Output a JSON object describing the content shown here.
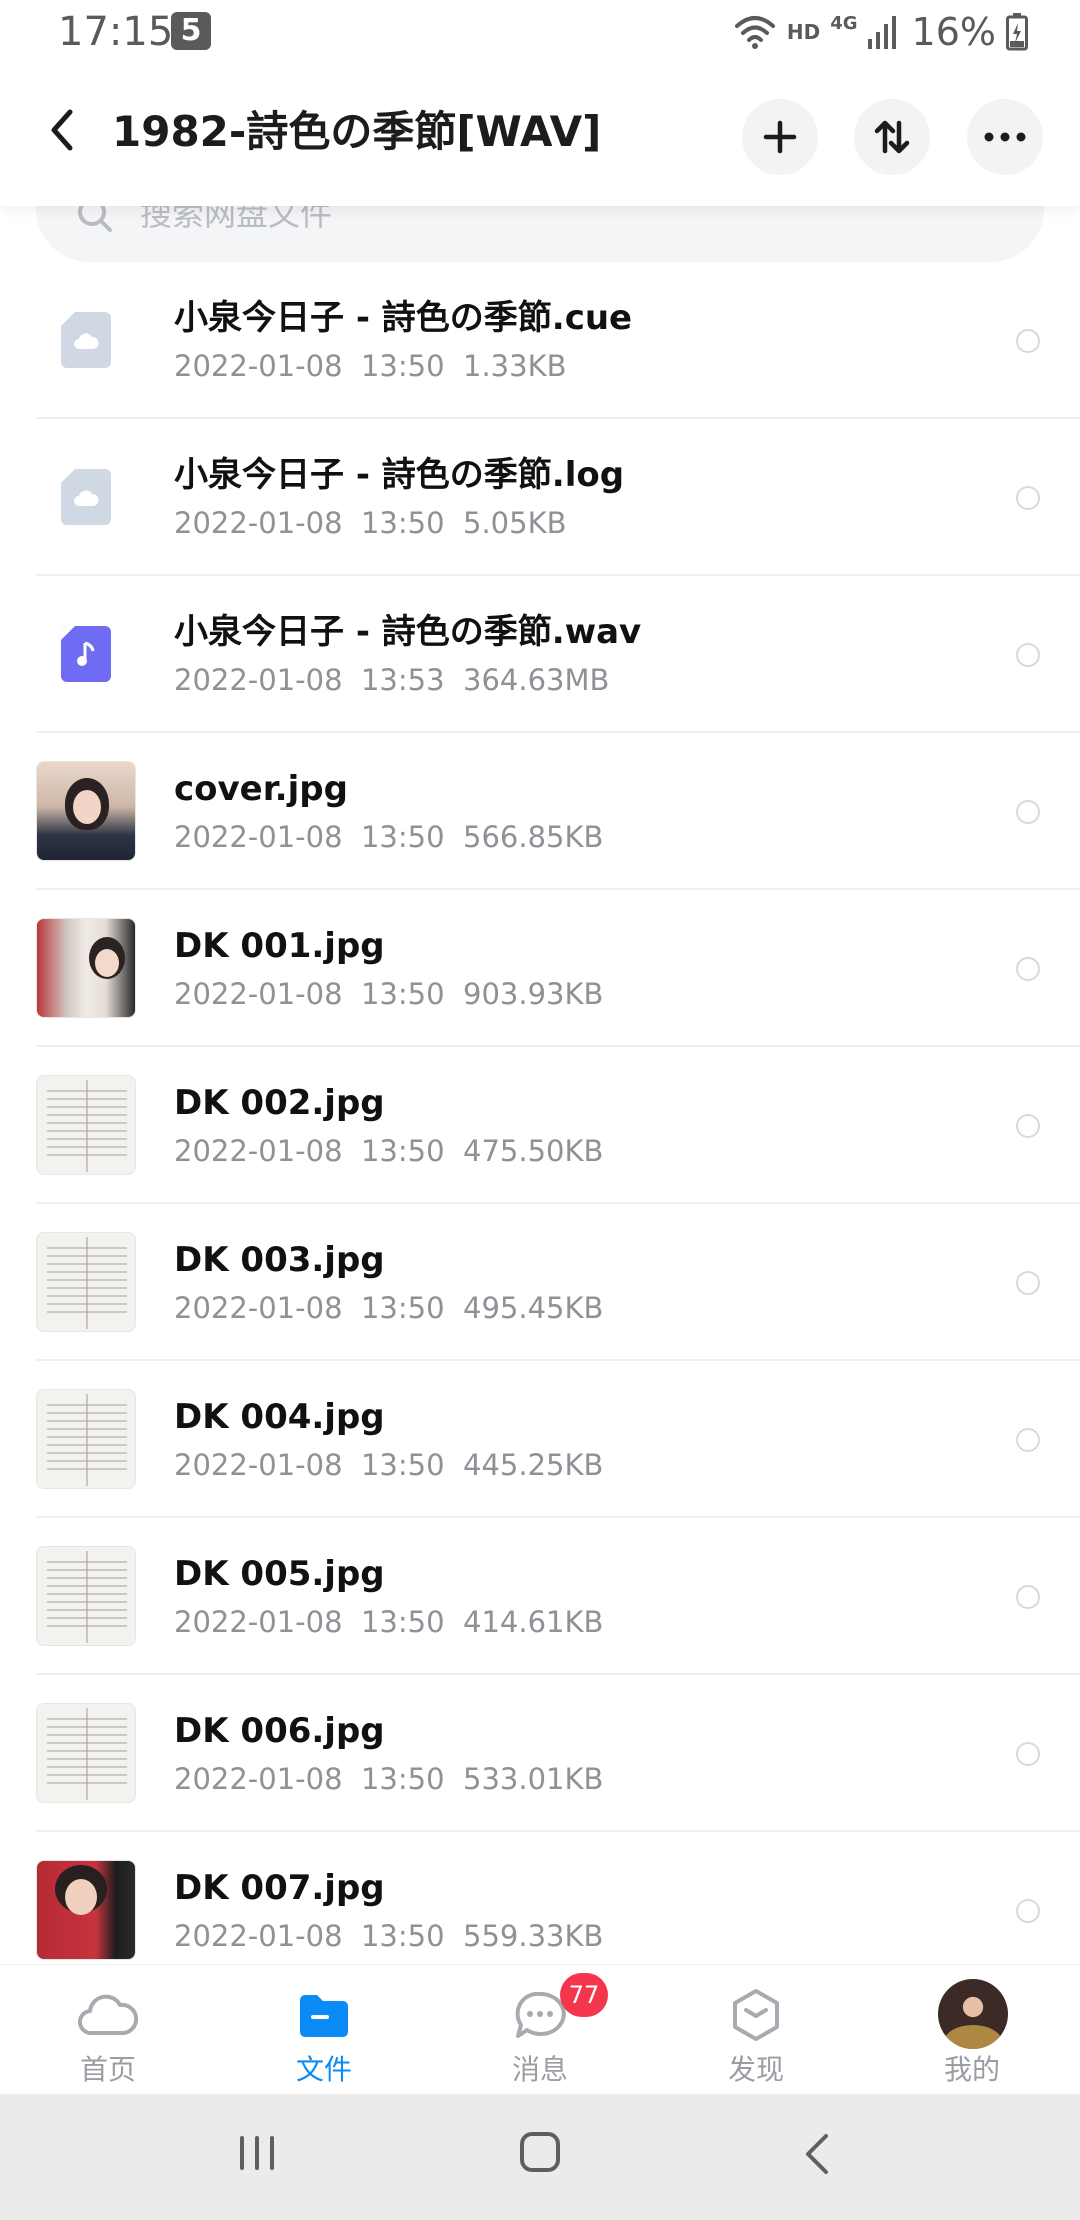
{
  "status_bar": {
    "time": "17:15",
    "notification_badge": "5",
    "network_hd": "HD",
    "network_type": "4G",
    "battery": "16%"
  },
  "header": {
    "title": "1982-詩色の季節[WAV]"
  },
  "search": {
    "placeholder": "搜索网盘文件"
  },
  "files": [
    {
      "name": "小泉今日子 - 詩色の季節.cue",
      "date": "2022-01-08",
      "time": "13:50",
      "size": "1.33KB",
      "icon": "doc-icon"
    },
    {
      "name": "小泉今日子 - 詩色の季節.log",
      "date": "2022-01-08",
      "time": "13:50",
      "size": "5.05KB",
      "icon": "doc-icon"
    },
    {
      "name": "小泉今日子 - 詩色の季節.wav",
      "date": "2022-01-08",
      "time": "13:53",
      "size": "364.63MB",
      "icon": "music-icon"
    },
    {
      "name": "cover.jpg",
      "date": "2022-01-08",
      "time": "13:50",
      "size": "566.85KB",
      "icon": "image-thumbnail"
    },
    {
      "name": "DK 001.jpg",
      "date": "2022-01-08",
      "time": "13:50",
      "size": "903.93KB",
      "icon": "image-thumbnail"
    },
    {
      "name": "DK 002.jpg",
      "date": "2022-01-08",
      "time": "13:50",
      "size": "475.50KB",
      "icon": "image-thumbnail"
    },
    {
      "name": "DK 003.jpg",
      "date": "2022-01-08",
      "time": "13:50",
      "size": "495.45KB",
      "icon": "image-thumbnail"
    },
    {
      "name": "DK 004.jpg",
      "date": "2022-01-08",
      "time": "13:50",
      "size": "445.25KB",
      "icon": "image-thumbnail"
    },
    {
      "name": "DK 005.jpg",
      "date": "2022-01-08",
      "time": "13:50",
      "size": "414.61KB",
      "icon": "image-thumbnail"
    },
    {
      "name": "DK 006.jpg",
      "date": "2022-01-08",
      "time": "13:50",
      "size": "533.01KB",
      "icon": "image-thumbnail"
    },
    {
      "name": "DK 007.jpg",
      "date": "2022-01-08",
      "time": "13:50",
      "size": "559.33KB",
      "icon": "image-thumbnail"
    }
  ],
  "bottom_nav": {
    "items": [
      {
        "label": "首页",
        "icon": "cloud-icon"
      },
      {
        "label": "文件",
        "icon": "folder-icon",
        "active": true
      },
      {
        "label": "消息",
        "icon": "chat-icon",
        "badge": "77"
      },
      {
        "label": "发现",
        "icon": "discover-icon"
      },
      {
        "label": "我的",
        "icon": "avatar"
      }
    ]
  },
  "colors": {
    "accent": "#0a8bf5",
    "badge": "#f4364c",
    "music_icon": "#6f6bf2",
    "doc_icon": "#cfd8e3"
  }
}
